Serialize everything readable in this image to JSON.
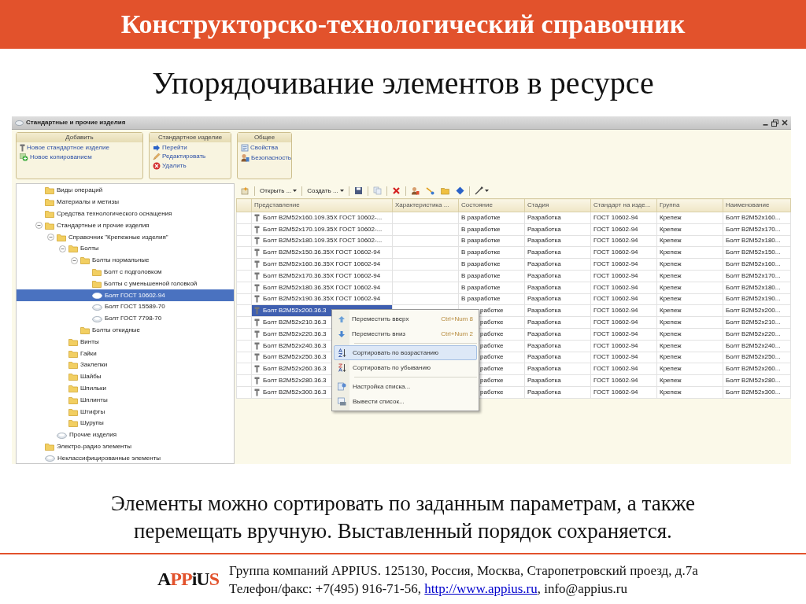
{
  "slide": {
    "title": "Конструкторско-технологический справочник",
    "subtitle": "Упорядочивание элементов в ресурсе",
    "caption": "Элементы можно сортировать по заданным параметрам, а также перемещать вручную. Выставленный порядок сохраняется."
  },
  "window": {
    "title": "Стандартные и прочие изделия"
  },
  "ribbon": [
    {
      "title": "Добавить",
      "links": [
        "Новое стандартное изделие",
        "Новое копированием"
      ]
    },
    {
      "title": "Стандартное изделие",
      "links": [
        "Перейти",
        "Редактировать",
        "Удалить"
      ]
    },
    {
      "title": "Общее",
      "links": [
        "Свойства",
        "Безопасность"
      ]
    }
  ],
  "tree": [
    {
      "label": "Виды операций",
      "kind": "folder",
      "selected": false
    },
    {
      "label": "Материалы и метизы",
      "kind": "folder",
      "selected": false
    },
    {
      "label": "Средства технологического оснащения",
      "kind": "folder",
      "selected": false
    },
    {
      "label": "Стандартные и прочие изделия",
      "kind": "folder",
      "selected": false,
      "expanded": true,
      "children": [
        {
          "label": "Справочник \"Крепежные изделия\"",
          "kind": "folder",
          "selected": false,
          "expanded": true,
          "children": [
            {
              "label": "Болты",
              "kind": "folder",
              "selected": false,
              "expanded": true,
              "children": [
                {
                  "label": "Болты нормальные",
                  "kind": "folder",
                  "selected": false,
                  "expanded": true,
                  "children": [
                    {
                      "label": "Болт с подголовком",
                      "kind": "folder",
                      "selected": false
                    },
                    {
                      "label": "Болты с уменьшенной головкой",
                      "kind": "folder",
                      "selected": false
                    },
                    {
                      "label": "Болт ГОСТ 10602-94",
                      "kind": "item",
                      "selected": true
                    },
                    {
                      "label": "Болт ГОСТ 15589-70",
                      "kind": "item",
                      "selected": false
                    },
                    {
                      "label": "Болт ГОСТ 7798-70",
                      "kind": "item",
                      "selected": false
                    }
                  ]
                },
                {
                  "label": "Болты откидные",
                  "kind": "folder",
                  "selected": false
                }
              ]
            },
            {
              "label": "Винты",
              "kind": "folder",
              "selected": false
            },
            {
              "label": "Гайки",
              "kind": "folder",
              "selected": false
            },
            {
              "label": "Заклепки",
              "kind": "folder",
              "selected": false
            },
            {
              "label": "Шайбы",
              "kind": "folder",
              "selected": false
            },
            {
              "label": "Шпильки",
              "kind": "folder",
              "selected": false
            },
            {
              "label": "Шплинты",
              "kind": "folder",
              "selected": false
            },
            {
              "label": "Штифты",
              "kind": "folder",
              "selected": false
            },
            {
              "label": "Шурупы",
              "kind": "folder",
              "selected": false
            }
          ]
        },
        {
          "label": "Прочие изделия",
          "kind": "item",
          "selected": false
        }
      ]
    },
    {
      "label": "Электро-радио элементы",
      "kind": "folder",
      "selected": false
    },
    {
      "label": "Неклассифицированные элементы",
      "kind": "item",
      "selected": false
    }
  ],
  "toolbar": {
    "open": "Открыть ...",
    "create": "Создать ..."
  },
  "table": {
    "columns": [
      "Представление",
      "Характеристика ...",
      "Состояние",
      "Стадия",
      "Стандарт на изде...",
      "Группа",
      "Наименование"
    ],
    "rows": [
      {
        "representation": "Болт B2M52x160.109.35X ГОСТ 10602-...",
        "state": "В разработке",
        "stage": "Разработка",
        "standard": "ГОСТ 10602-94",
        "group": "Крепеж",
        "name": "Болт B2M52x160...",
        "selected": false
      },
      {
        "representation": "Болт B2M52x170.109.35X ГОСТ 10602-...",
        "state": "В разработке",
        "stage": "Разработка",
        "standard": "ГОСТ 10602-94",
        "group": "Крепеж",
        "name": "Болт B2M52x170...",
        "selected": false
      },
      {
        "representation": "Болт B2M52x180.109.35X ГОСТ 10602-...",
        "state": "В разработке",
        "stage": "Разработка",
        "standard": "ГОСТ 10602-94",
        "group": "Крепеж",
        "name": "Болт B2M52x180...",
        "selected": false
      },
      {
        "representation": "Болт B2M52x150.36.35X ГОСТ 10602-94",
        "state": "В разработке",
        "stage": "Разработка",
        "standard": "ГОСТ 10602-94",
        "group": "Крепеж",
        "name": "Болт B2M52x150...",
        "selected": false
      },
      {
        "representation": "Болт B2M52x160.36.35X ГОСТ 10602-94",
        "state": "В разработке",
        "stage": "Разработка",
        "standard": "ГОСТ 10602-94",
        "group": "Крепеж",
        "name": "Болт B2M52x160...",
        "selected": false
      },
      {
        "representation": "Болт B2M52x170.36.35X ГОСТ 10602-94",
        "state": "В разработке",
        "stage": "Разработка",
        "standard": "ГОСТ 10602-94",
        "group": "Крепеж",
        "name": "Болт B2M52x170...",
        "selected": false
      },
      {
        "representation": "Болт B2M52x180.36.35X ГОСТ 10602-94",
        "state": "В разработке",
        "stage": "Разработка",
        "standard": "ГОСТ 10602-94",
        "group": "Крепеж",
        "name": "Болт B2M52x180...",
        "selected": false
      },
      {
        "representation": "Болт B2M52x190.36.35X ГОСТ 10602-94",
        "state": "В разработке",
        "stage": "Разработка",
        "standard": "ГОСТ 10602-94",
        "group": "Крепеж",
        "name": "Болт B2M52x190...",
        "selected": false
      },
      {
        "representation": "Болт B2M52x200.36.3",
        "state": "работке",
        "stage": "Разработка",
        "standard": "ГОСТ 10602-94",
        "group": "Крепеж",
        "name": "Болт B2M52x200...",
        "selected": true
      },
      {
        "representation": "Болт B2M52x210.36.3",
        "state": "работке",
        "stage": "Разработка",
        "standard": "ГОСТ 10602-94",
        "group": "Крепеж",
        "name": "Болт B2M52x210...",
        "selected": false
      },
      {
        "representation": "Болт B2M52x220.36.3",
        "state": "работке",
        "stage": "Разработка",
        "standard": "ГОСТ 10602-94",
        "group": "Крепеж",
        "name": "Болт B2M52x220...",
        "selected": false
      },
      {
        "representation": "Болт B2M52x240.36.3",
        "state": "работке",
        "stage": "Разработка",
        "standard": "ГОСТ 10602-94",
        "group": "Крепеж",
        "name": "Болт B2M52x240...",
        "selected": false
      },
      {
        "representation": "Болт B2M52x250.36.3",
        "state": "работке",
        "stage": "Разработка",
        "standard": "ГОСТ 10602-94",
        "group": "Крепеж",
        "name": "Болт B2M52x250...",
        "selected": false
      },
      {
        "representation": "Болт B2M52x260.36.3",
        "state": "работке",
        "stage": "Разработка",
        "standard": "ГОСТ 10602-94",
        "group": "Крепеж",
        "name": "Болт B2M52x260...",
        "selected": false
      },
      {
        "representation": "Болт B2M52x280.36.3",
        "state": "работке",
        "stage": "Разработка",
        "standard": "ГОСТ 10602-94",
        "group": "Крепеж",
        "name": "Болт B2M52x280...",
        "selected": false
      },
      {
        "representation": "Болт B2M52x300.36.3",
        "state": "работке",
        "stage": "Разработка",
        "standard": "ГОСТ 10602-94",
        "group": "Крепеж",
        "name": "Болт B2M52x300...",
        "selected": false
      }
    ]
  },
  "context_menu": {
    "groups": [
      [
        {
          "label": "Переместить вверх",
          "shortcut": "Ctrl+Num 8",
          "selected": false
        },
        {
          "label": "Переместить вниз",
          "shortcut": "Ctrl+Num 2",
          "selected": false
        }
      ],
      [
        {
          "label": "Сортировать по возрастанию",
          "selected": true
        },
        {
          "label": "Сортировать по убыванию",
          "selected": false
        }
      ],
      [
        {
          "label": "Настройка списка...",
          "selected": false
        },
        {
          "label": "Вывести список...",
          "selected": false
        }
      ]
    ]
  },
  "footer": {
    "logo": [
      {
        "text": "A",
        "accent": false
      },
      {
        "text": "PP",
        "accent": true
      },
      {
        "text": "iU",
        "accent": false
      },
      {
        "text": "S",
        "accent": true
      }
    ],
    "address": "Группа компаний APPIUS. 125130, Россия, Москва, Старопетровский проезд, д.7а",
    "phone": "Телефон/факс: +7(495) 916-71-56, ",
    "link": "http://www.appius.ru",
    "email": ", info@appius.ru"
  }
}
